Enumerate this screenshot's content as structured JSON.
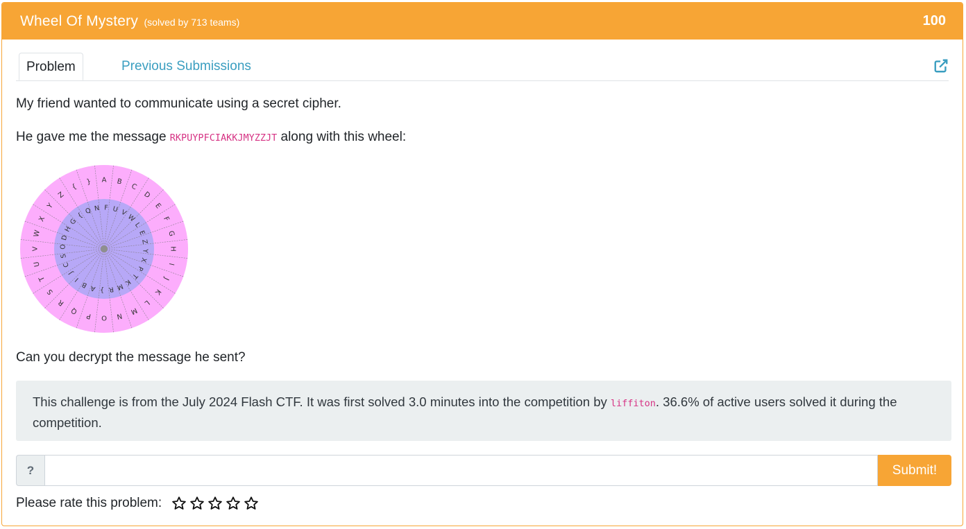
{
  "header": {
    "title": "Wheel Of Mystery",
    "solved": "(solved by 713 teams)",
    "points": "100"
  },
  "tabs": [
    {
      "label": "Problem",
      "active": true
    },
    {
      "label": "Previous Submissions",
      "active": false
    }
  ],
  "problem": {
    "intro": "My friend wanted to communicate using a secret cipher.",
    "message_prefix": "He gave me the message",
    "message_code": "RKPUYPFCIAKKJMYZZJT",
    "message_suffix": "along with this wheel:",
    "question": "Can you decrypt the message he sent?"
  },
  "wheel": {
    "outer_letters": [
      "A",
      "B",
      "C",
      "D",
      "E",
      "F",
      "G",
      "H",
      "I",
      "J",
      "K",
      "L",
      "M",
      "N",
      "O",
      "P",
      "Q",
      "R",
      "S",
      "T",
      "U",
      "V",
      "W",
      "X",
      "Y",
      "Z",
      "{",
      "}"
    ],
    "inner_letters": [
      "N",
      "F",
      "U",
      "V",
      "W",
      "L",
      "E",
      "Z",
      "Y",
      "X",
      "P",
      "T",
      "K",
      "M",
      "R",
      "}",
      "A",
      "B",
      "I",
      "J",
      "C",
      "S",
      "O",
      "D",
      "H",
      "G",
      "{",
      "Q"
    ],
    "outer_color": "#fcadfc",
    "inner_color": "#b7a8f7"
  },
  "note": {
    "text_before": "This challenge is from the July 2024 Flash CTF. It was first solved 3.0 minutes into the competition by",
    "solver": "liffiton",
    "text_after": ". 36.6% of active users solved it during the competition."
  },
  "flag_form": {
    "prefix": "?",
    "placeholder": "",
    "value": "",
    "submit_label": "Submit!"
  },
  "rating": {
    "label": "Please rate this problem:",
    "max_stars": 5,
    "current": 0
  },
  "colors": {
    "accent": "#f7a535",
    "link": "#3a9ec0",
    "code": "#d63384"
  }
}
